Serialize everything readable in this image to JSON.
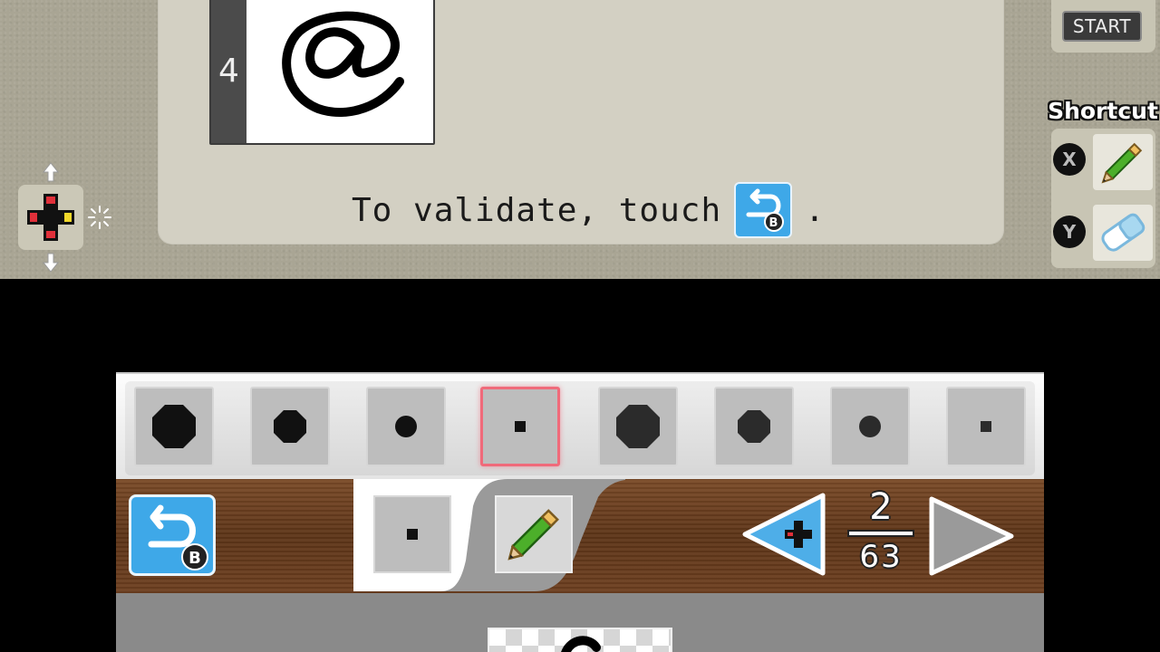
{
  "top_screen": {
    "sample_index": "4",
    "sample_glyph_name": "at-sign-handwritten",
    "instruction_before": "To validate, touch",
    "instruction_after": ".",
    "start_label": "START",
    "shortcut_title": "Shortcut",
    "shortcuts": [
      {
        "button": "X",
        "tool_icon": "pencil-icon"
      },
      {
        "button": "Y",
        "tool_icon": "eraser-icon"
      }
    ]
  },
  "bottom_screen": {
    "brush_sizes": [
      {
        "shape": "octagon",
        "size": "large",
        "selected": false
      },
      {
        "shape": "octagon",
        "size": "medium",
        "selected": false
      },
      {
        "shape": "circle",
        "size": "small",
        "selected": false
      },
      {
        "shape": "square",
        "size": "tiny",
        "selected": true
      },
      {
        "shape": "octagon",
        "size": "large",
        "selected": false
      },
      {
        "shape": "octagon",
        "size": "medium",
        "selected": false
      },
      {
        "shape": "circle",
        "size": "small",
        "selected": false
      },
      {
        "shape": "square",
        "size": "tiny",
        "selected": false
      }
    ],
    "back_button_badge": "B",
    "undo_badge": "B",
    "page_current": "2",
    "page_total": "63"
  },
  "colors": {
    "accent_blue": "#3ea8e8",
    "selected_border": "#f06a7a",
    "brush_ink": "#111111"
  }
}
